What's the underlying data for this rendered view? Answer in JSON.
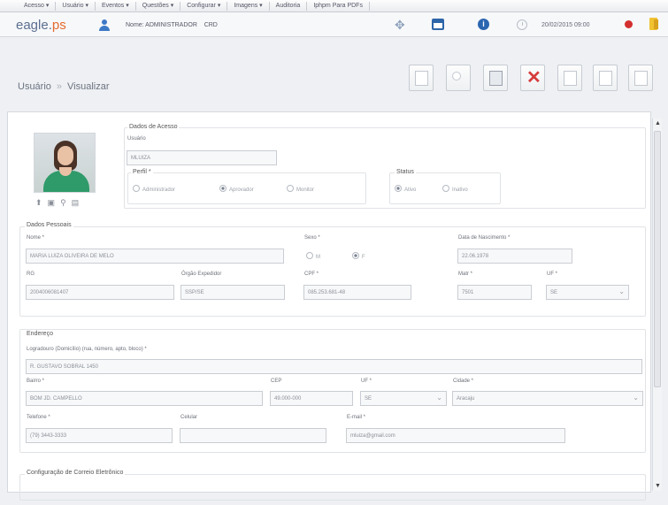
{
  "menu": [
    "Acesso ▾",
    "Usuário ▾",
    "Eventos ▾",
    "Questões ▾",
    "Configurar ▾",
    "Imagens ▾",
    "Auditoria",
    "Iphpm Para PDFs"
  ],
  "header": {
    "logo_main": "eagle.",
    "logo_ext": "ps",
    "user_label": "Nome: ADMINISTRADOR",
    "user_role": "CRD",
    "datetime": "20/02/2015 09:00",
    "icons": [
      "user-icon",
      "expand-icon",
      "window-icon",
      "info-icon",
      "clock-icon",
      "power-icon",
      "exit-icon"
    ]
  },
  "breadcrumb": {
    "root": "Usuário",
    "sep": "»",
    "current": "Visualizar"
  },
  "toolbar": [
    "new-icon",
    "search-icon",
    "save-icon",
    "delete-icon",
    "edit-icon",
    "print-icon",
    "report-icon"
  ],
  "access": {
    "title": "Dados de Acesso",
    "username_label": "Usuário",
    "username_value": "MLUIZA",
    "profile_label": "Perfil *",
    "profile_options": [
      "Administrador",
      "Aprovador",
      "Monitor"
    ],
    "profile_selected": 1,
    "status_label": "Status",
    "status_options": [
      "Ativo",
      "Inativo"
    ],
    "status_selected": 0
  },
  "personal": {
    "title": "Dados Pessoais",
    "name_label": "Nome *",
    "name_value": "MARIA LUIZA OLIVEIRA DE MELO",
    "sex_label": "Sexo *",
    "sex_options": [
      "M",
      "F"
    ],
    "sex_selected": 1,
    "birth_label": "Data de Nascimento *",
    "birth_value": "22.06.1978",
    "rg_label": "RG",
    "rg_value": "2004006081407",
    "issuer_label": "Órgão Expedidor",
    "issuer_value": "SSP/SE",
    "cpf_label": "CPF *",
    "cpf_value": "085.253.681-48",
    "mat_label": "Matr *",
    "mat_value": "7501",
    "uf_label": "UF *",
    "uf_value": "SE"
  },
  "address": {
    "title": "Endereço",
    "street_label": "Logradouro (Domicílio) (rua, número, apto, bloco) *",
    "street_value": "R. GUSTAVO SOBRAL 1450",
    "district_label": "Bairro *",
    "district_value": "BOM JD. CAMPELLO",
    "cep_label": "CEP",
    "cep_value": "49.000-000",
    "uf_label": "UF *",
    "uf_value": "SE",
    "city_label": "Cidade *",
    "city_value": "Aracaju",
    "phone_label": "Telefone *",
    "phone_value": "(79) 3443-3333",
    "mobile_label": "Celular",
    "mobile_value": "",
    "email_label": "E-mail *",
    "email_value": "mluiza@gmail.com"
  },
  "email_config": {
    "title": "Configuração de Correio Eletrônico"
  }
}
